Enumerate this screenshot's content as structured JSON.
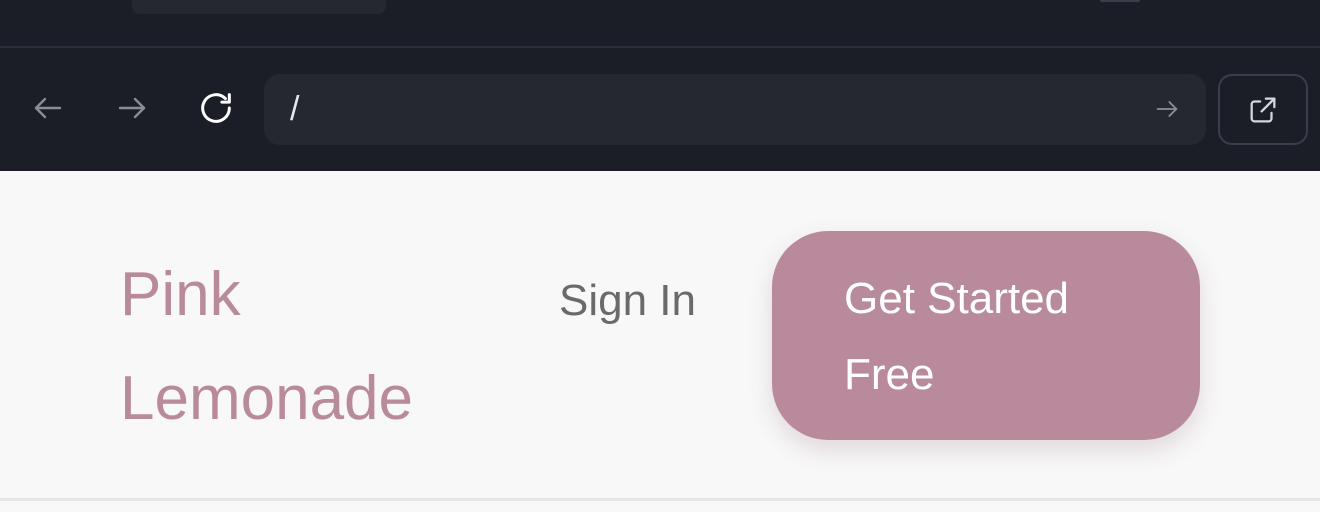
{
  "browser": {
    "address": {
      "value": "/"
    },
    "icons": {
      "back": "arrow-left-icon",
      "forward": "arrow-right-icon",
      "reload": "reload-icon",
      "go": "arrow-right-icon",
      "open_external": "external-link-icon"
    }
  },
  "site": {
    "brand": "Pink Lemonade",
    "nav": {
      "sign_in": "Sign In"
    },
    "cta": {
      "label": "Get Started Free"
    }
  },
  "colors": {
    "chrome_bg": "#1b1e27",
    "address_bg": "#252831",
    "page_bg": "#f8f8f8",
    "brand": "#b98a9b",
    "cta_bg": "#b98a9b",
    "nav_text": "#6a6a6a"
  }
}
